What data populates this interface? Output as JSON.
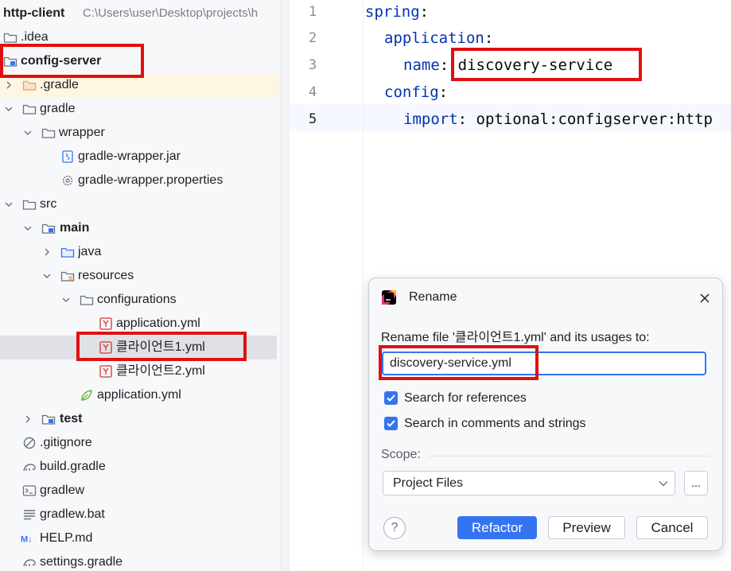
{
  "tree": {
    "root": {
      "label": "http-client",
      "path": "C:\\Users\\user\\Desktop\\projects\\h"
    },
    "items": [
      {
        "label": ".idea"
      },
      {
        "label": "config-server"
      },
      {
        "label": ".gradle"
      },
      {
        "label": "gradle"
      },
      {
        "label": "wrapper"
      },
      {
        "label": "gradle-wrapper.jar"
      },
      {
        "label": "gradle-wrapper.properties"
      },
      {
        "label": "src"
      },
      {
        "label": "main"
      },
      {
        "label": "java"
      },
      {
        "label": "resources"
      },
      {
        "label": "configurations"
      },
      {
        "label": "application.yml"
      },
      {
        "label": "클라이언트1.yml"
      },
      {
        "label": "클라이언트2.yml"
      },
      {
        "label": "application.yml"
      },
      {
        "label": "test"
      },
      {
        "label": ".gitignore"
      },
      {
        "label": "build.gradle"
      },
      {
        "label": "gradlew"
      },
      {
        "label": "gradlew.bat"
      },
      {
        "label": "HELP.md"
      },
      {
        "label": "settings.gradle"
      }
    ]
  },
  "editor": {
    "line_numbers": [
      "1",
      "2",
      "3",
      "4",
      "5"
    ],
    "lines": [
      {
        "key": "spring",
        "colon": ":"
      },
      {
        "key": "application",
        "colon": ":"
      },
      {
        "key": "name",
        "colon": ":",
        "value": "discovery-service"
      },
      {
        "key": "config",
        "colon": ":"
      },
      {
        "key": "import",
        "colon": ":",
        "value": "optional:configserver:http"
      }
    ]
  },
  "dialog": {
    "title": "Rename",
    "prompt": "Rename file '클라이언트1.yml' and its usages to:",
    "new_name": "discovery-service.yml",
    "search_references": {
      "label": "Search for references",
      "checked": true
    },
    "search_comments": {
      "label": "Search in comments and strings",
      "checked": true
    },
    "scope_label": "Scope:",
    "scope_value": "Project Files",
    "more_label": "...",
    "help_label": "?",
    "refactor_label": "Refactor",
    "preview_label": "Preview",
    "cancel_label": "Cancel"
  },
  "colors": {
    "accent": "#3574f0",
    "annotation_box": "#e01010",
    "yaml_key": "#0033b3"
  },
  "icons": [
    "folder-icon",
    "module-folder-icon",
    "yaml-file-icon",
    "jar-file-icon",
    "settings-file-icon",
    "gitignore-icon",
    "gradle-icon",
    "terminal-file-icon",
    "text-file-icon",
    "markdown-icon",
    "spring-icon",
    "jetbrains-icon",
    "close-icon",
    "chevron-down-icon",
    "checkmark-icon"
  ]
}
